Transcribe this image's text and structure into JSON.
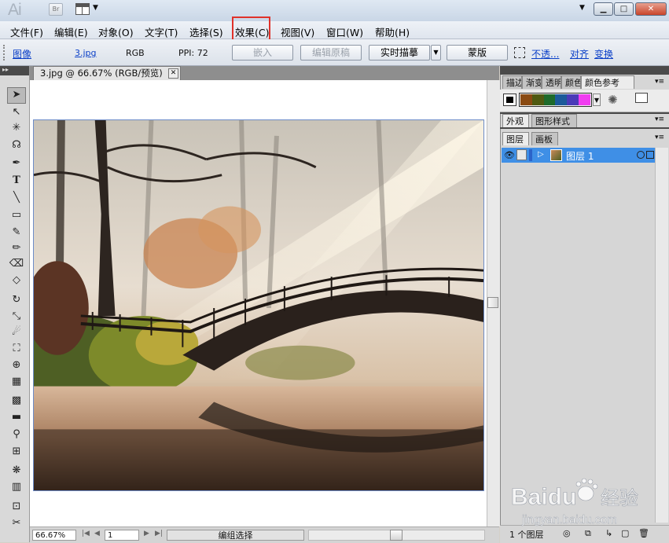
{
  "app": {
    "logo": "Ai",
    "bridge_label": "Br",
    "window_buttons": [
      "▁",
      "□",
      "✕"
    ]
  },
  "menubar": {
    "items": [
      "文件(F)",
      "编辑(E)",
      "对象(O)",
      "文字(T)",
      "选择(S)",
      "效果(C)",
      "视图(V)",
      "窗口(W)",
      "帮助(H)"
    ],
    "highlighted": "效果(C)"
  },
  "controlbar": {
    "type_label": "图像",
    "file_link": "3.jpg",
    "color_mode": "RGB",
    "ppi_label": "PPI: 72",
    "embed_button": "嵌入",
    "edit_original_button": "编辑原稿",
    "live_trace_button": "实时描摹",
    "mask_button": "蒙版",
    "opacity_link": "不透...",
    "align_link": "对齐",
    "transform_link": "变换"
  },
  "document": {
    "tab_title": "3.jpg @ 66.67% (RGB/预览)",
    "close_label": "✕"
  },
  "statusbar": {
    "zoom": "66.67%",
    "artboard": "1",
    "status_text": "编组选择"
  },
  "panels": {
    "top_tabs": [
      "描边",
      "渐变",
      "透明",
      "颜色",
      "颜色参考"
    ],
    "active_top_tab": "颜色参考",
    "mid_tabs": [
      "外观",
      "图形样式"
    ],
    "layer_tabs": [
      "图层",
      "画板"
    ],
    "layer_name": "图层 1",
    "layer_count": "1 个图层",
    "swatch_colors": [
      "#000000",
      "#8a4a12",
      "#4f5a12",
      "#1e6b2b",
      "#1c5a9a",
      "#4a3ab8",
      "#f03cf0"
    ]
  },
  "watermark": {
    "brand": "Baidu",
    "brand_suffix": "经验",
    "url": "jingyan.baidu.com"
  },
  "colors": {
    "highlight_box": "#e0322a",
    "selection_blue": "#3f8fe6",
    "link_blue": "#0a3fc8"
  }
}
